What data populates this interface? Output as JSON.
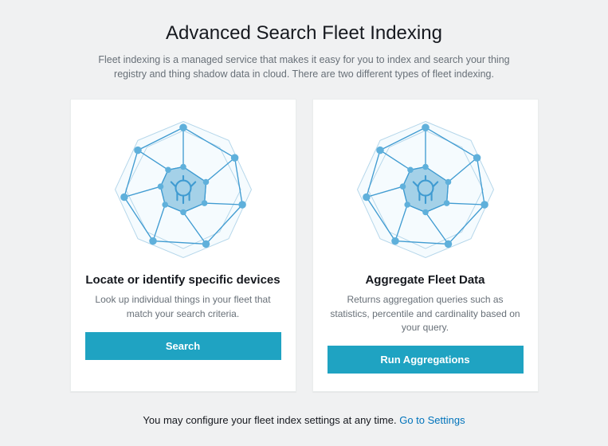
{
  "header": {
    "title": "Advanced Search Fleet Indexing",
    "subtitle": "Fleet indexing is a managed service that makes it easy for you to index and search your thing registry and thing shadow data in cloud. There are two different types of fleet indexing."
  },
  "cards": [
    {
      "title": "Locate or identify specific devices",
      "description": "Look up individual things in your fleet that match your search criteria.",
      "button": "Search",
      "icon": "network-sphere-icon"
    },
    {
      "title": "Aggregate Fleet Data",
      "description": "Returns aggregation queries such as statistics, percentile and cardinality based on your query.",
      "button": "Run Aggregations",
      "icon": "network-sphere-icon"
    }
  ],
  "footer": {
    "text": "You may configure your fleet index settings at any time. ",
    "linkText": "Go to Settings"
  }
}
